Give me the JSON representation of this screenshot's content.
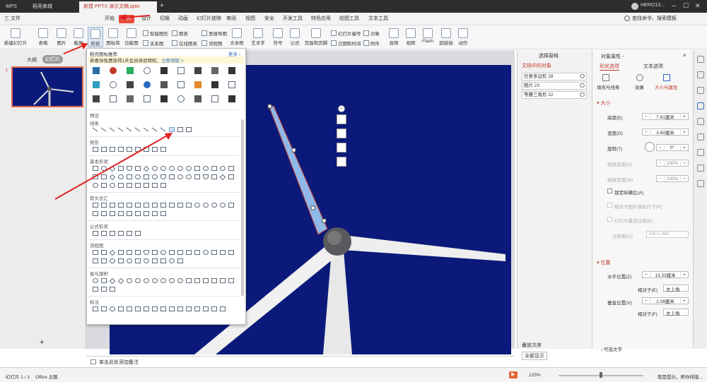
{
  "tabs": [
    {
      "label": "WPS"
    },
    {
      "label": "稻壳商城"
    },
    {
      "label": "新建 PPTX 演示文稿.pptx"
    }
  ],
  "titlebar_right": "HERO13...",
  "menu": {
    "file": "三 文件",
    "items": [
      "开始",
      "插入",
      "设计",
      "切换",
      "动画",
      "幻灯片放映",
      "审阅",
      "视图",
      "安全",
      "开发工具",
      "特色应用",
      "绘图工具",
      "文本工具"
    ],
    "search": "查找命令、搜索模板"
  },
  "ribbon": {
    "new_slide": "新建幻灯片",
    "table": "表格",
    "picture": "图片",
    "screenshot": "截屏",
    "shapes": "形状",
    "icon_lib": "图标库",
    "func_chart": "功能图",
    "smart": "智能图形",
    "relation": "关系图",
    "chart": "图表",
    "online_chart": "在线图表",
    "mindmap": "思维导图",
    "flow": "流程图",
    "textbox": "文本框",
    "wordart": "艺术字",
    "symbol": "符号",
    "formula": "公式",
    "header_footer": "页眉和页脚",
    "slide_no": "幻灯片编号",
    "datetime": "日期和时间",
    "object": "对象",
    "attach": "附件",
    "audio": "音频",
    "video": "视频",
    "flash": "Flash",
    "hyperlink": "超链接",
    "action": "动作"
  },
  "left_panel": {
    "outline": "大纲",
    "slides": "幻灯片",
    "slide_number": "1"
  },
  "shapes_menu": {
    "header": "稻壳图标推荐",
    "more": "更多 ›",
    "promo": "恭喜你免费获得1天会员体验特权，",
    "promo_link": "立即领取 >",
    "preset": "预设",
    "sections": [
      "线条",
      "矩形",
      "基本形状",
      "箭头总汇",
      "公式形状",
      "流程图",
      "星与旗帜",
      "标注"
    ]
  },
  "notes_placeholder": "单击此处添加备注",
  "selection_panel": {
    "title": "选择窗格",
    "subtitle": "文档中的对象",
    "objects": [
      "任意多边形 28",
      "图片 23",
      "等腰三角形 22"
    ],
    "order": "叠放次序",
    "show_all": "全部显示"
  },
  "prop_panel": {
    "title": "对象属性 -",
    "tab_shape": "形状选项",
    "tab_text": "文本选项",
    "sub_fill": "填充与线条",
    "sub_effect": "效果",
    "sub_size": "大小与属性",
    "size_header": "▾ 大小",
    "height_label": "高度(E)",
    "height_value": "7.61厘米",
    "width_label": "宽度(D)",
    "width_value": "3.60厘米",
    "rotate_label": "旋转(T)",
    "rotate_value": "0°",
    "scale_h_label": "缩放高度(H)",
    "scale_h_value": "100%",
    "scale_w_label": "缩放宽度(W)",
    "scale_w_value": "100%",
    "lock_ratio": "锁定纵横比(A)",
    "relative_orig": "相对于图片原始尺寸(R)",
    "best_scale": "幻灯片最佳比例(B)",
    "resolution_label": "分辨率(O)",
    "resolution_value": "640 x 480",
    "pos_header": "▾ 位置",
    "hpos_label": "水平位置(Z)",
    "hpos_value": "13.33厘米",
    "hrel_label": "相对于(E)",
    "hrel_value": "左上角",
    "vpos_label": "垂直位置(V)",
    "vpos_value": "2.08厘米",
    "vrel_label": "相对于(F)",
    "vrel_value": "左上角",
    "optional_text": "› 可选文字"
  },
  "status": {
    "slide": "幻灯片 1 / 1",
    "theme": "Office 主题",
    "zoom": "125%",
    "tip": "我是提示，帮你排版..."
  },
  "colors": {
    "accent": "#e74c3c",
    "slide_bg": "#0b1a7a",
    "selected_shape": "#8fb8e8"
  }
}
